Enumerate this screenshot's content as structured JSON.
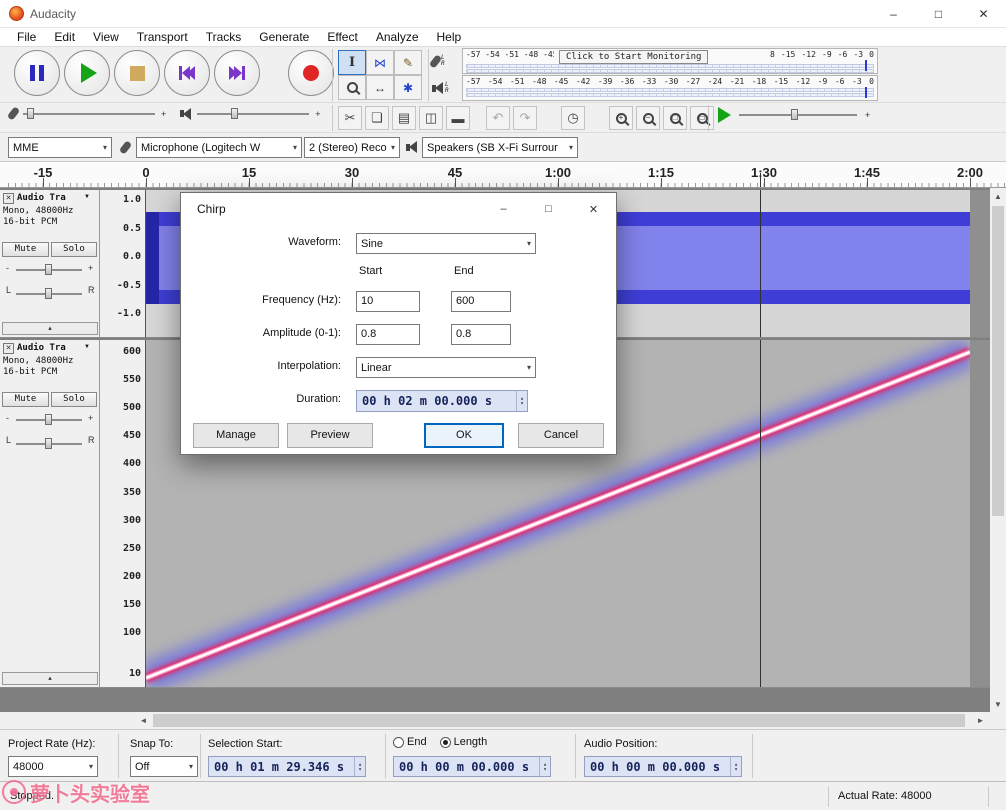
{
  "titlebar": {
    "title": "Audacity"
  },
  "menu": {
    "items": [
      "File",
      "Edit",
      "View",
      "Transport",
      "Tracks",
      "Generate",
      "Effect",
      "Analyze",
      "Help"
    ]
  },
  "meters": {
    "record_left": "-57 -54 -51 -48 -45",
    "monitor_label": "Click to Start Monitoring",
    "record_right": "8 -15 -12 -9 -6 -3 0",
    "play_scale": "-57 -54 -51 -48 -45 -42 -39 -36 -33 -30 -27 -24 -21 -18 -15 -12 -9 -6 -3 0",
    "channel_left": "L",
    "channel_right": "R"
  },
  "device": {
    "host": "MME",
    "input": "Microphone (Logitech W",
    "channels": "2 (Stereo) Reco",
    "output": "Speakers (SB X-Fi Surrour"
  },
  "timeline": {
    "labels": [
      "-15",
      "0",
      "15",
      "30",
      "45",
      "1:00",
      "1:15",
      "1:30",
      "1:45",
      "2:00"
    ]
  },
  "tracks": [
    {
      "name": "Audio Tra",
      "format": "Mono, 48000Hz",
      "depth": "16-bit PCM",
      "mute": "Mute",
      "solo": "Solo",
      "ruler": [
        "1.0",
        "0.5",
        "0.0",
        "-0.5",
        "-1.0"
      ]
    },
    {
      "name": "Audio Tra",
      "format": "Mono, 48000Hz",
      "depth": "16-bit PCM",
      "mute": "Mute",
      "solo": "Solo",
      "ruler": [
        "600",
        "550",
        "500",
        "450",
        "400",
        "350",
        "300",
        "250",
        "200",
        "150",
        "100",
        "10"
      ]
    }
  ],
  "dialog": {
    "title": "Chirp",
    "waveform_label": "Waveform:",
    "waveform_value": "Sine",
    "start_header": "Start",
    "end_header": "End",
    "frequency_label": "Frequency (Hz):",
    "frequency_start": "10",
    "frequency_end": "600",
    "amplitude_label": "Amplitude (0-1):",
    "amplitude_start": "0.8",
    "amplitude_end": "0.8",
    "interpolation_label": "Interpolation:",
    "interpolation_value": "Linear",
    "duration_label": "Duration:",
    "duration_value": "00 h 02 m 00.000 s",
    "manage_button": "Manage",
    "preview_button": "Preview",
    "ok_button": "OK",
    "cancel_button": "Cancel"
  },
  "selection_bar": {
    "project_rate_label": "Project Rate (Hz):",
    "project_rate_value": "48000",
    "snap_label": "Snap To:",
    "snap_value": "Off",
    "selection_start_label": "Selection Start:",
    "selection_start_value": "00 h 01 m 29.346 s",
    "end_option": "End",
    "length_option": "Length",
    "length_value": "00 h 00 m 00.000 s",
    "audio_position_label": "Audio Position:",
    "audio_position_value": "00 h 00 m 00.000 s"
  },
  "status": {
    "state": "Stopped.",
    "actual_rate": "Actual Rate: 48000"
  },
  "watermark": {
    "text": "萝卜头实验室"
  },
  "icons": {
    "minimize": "–",
    "maximize": "□",
    "close": "✕",
    "chevron": "▾",
    "spin_up": "▴",
    "spin_down": "▾",
    "track_close": "✕",
    "track_menu": "▼",
    "collapse_up": "▴",
    "envelope": "⋈",
    "draw": "✎",
    "timeshift": "↔",
    "multi": "✱",
    "ibeam": "I",
    "cut": "✂",
    "copy": "❏",
    "paste": "▤",
    "trim": "◫",
    "silence": "▬",
    "undo": "↶",
    "redo": "↷",
    "timer": "◷",
    "zoom_in_sign": "+",
    "zoom_out_sign": "−",
    "zoom_sel_sign": "□",
    "zoom_fit_sign": "▭",
    "plus": "+",
    "minus": "-",
    "pan_left": "L",
    "pan_right": "R",
    "scroll_left": "◄",
    "scroll_right": "►",
    "scroll_up": "▲",
    "scroll_down": "▼"
  }
}
